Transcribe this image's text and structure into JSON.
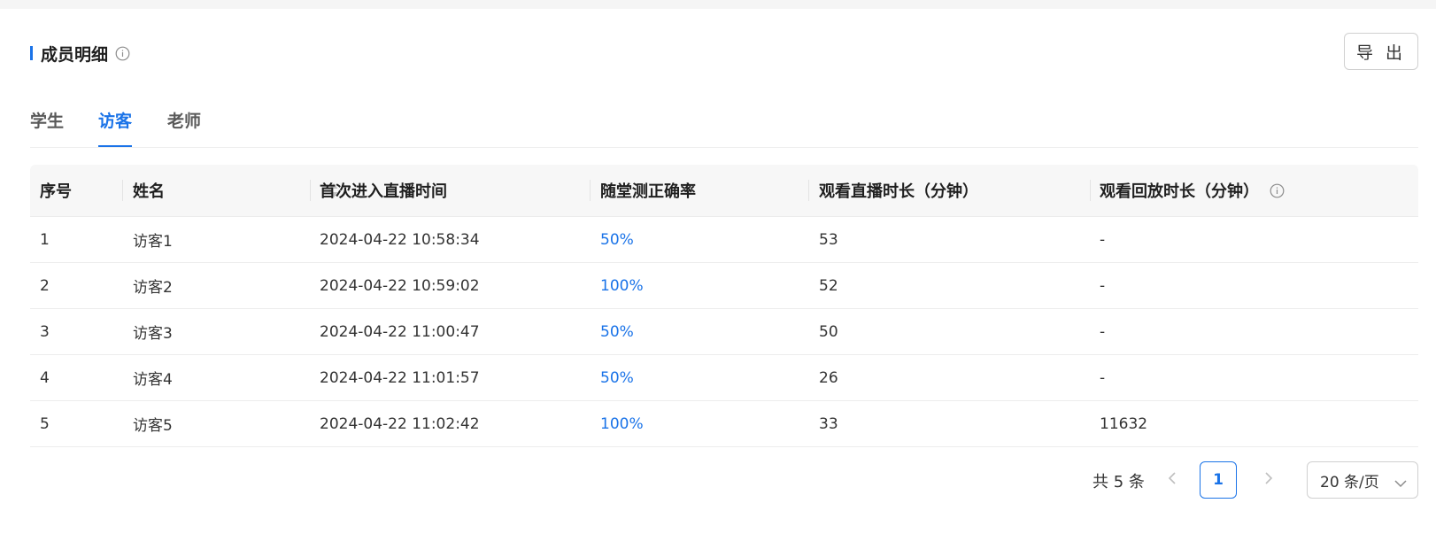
{
  "header": {
    "title": "成员明细",
    "export_label": "导 出"
  },
  "tabs": [
    {
      "label": "学生",
      "active": false
    },
    {
      "label": "访客",
      "active": true
    },
    {
      "label": "老师",
      "active": false
    }
  ],
  "table": {
    "columns": [
      "序号",
      "姓名",
      "首次进入直播时间",
      "随堂测正确率",
      "观看直播时长（分钟）",
      "观看回放时长（分钟）"
    ],
    "rows": [
      {
        "index": "1",
        "name": "访客1",
        "first_entry": "2024-04-22 10:58:34",
        "accuracy": "50%",
        "live_minutes": "53",
        "replay_minutes": "-"
      },
      {
        "index": "2",
        "name": "访客2",
        "first_entry": "2024-04-22 10:59:02",
        "accuracy": "100%",
        "live_minutes": "52",
        "replay_minutes": "-"
      },
      {
        "index": "3",
        "name": "访客3",
        "first_entry": "2024-04-22 11:00:47",
        "accuracy": "50%",
        "live_minutes": "50",
        "replay_minutes": "-"
      },
      {
        "index": "4",
        "name": "访客4",
        "first_entry": "2024-04-22 11:01:57",
        "accuracy": "50%",
        "live_minutes": "26",
        "replay_minutes": "-"
      },
      {
        "index": "5",
        "name": "访客5",
        "first_entry": "2024-04-22 11:02:42",
        "accuracy": "100%",
        "live_minutes": "33",
        "replay_minutes": "11632"
      }
    ]
  },
  "pagination": {
    "total": "共 5 条",
    "current_page": "1",
    "page_size": "20 条/页"
  },
  "colors": {
    "accent": "#1a73e8",
    "text": "#333333",
    "header_bg": "#f7f7f7"
  },
  "icons": [
    "info-icon",
    "sort-icon",
    "chevron-left-icon",
    "chevron-right-icon",
    "chevron-down-icon"
  ]
}
